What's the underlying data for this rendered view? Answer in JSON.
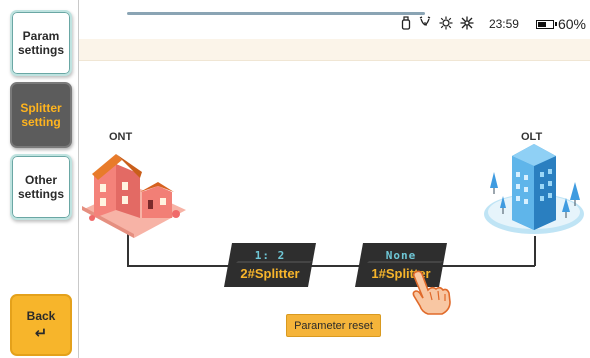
{
  "sidebar": {
    "param_settings": "Param settings",
    "splitter_setting": "Splitter setting",
    "other_settings": "Other settings",
    "back": "Back",
    "back_icon": "↵"
  },
  "status_bar": {
    "icons": [
      "usb-icon",
      "alarm-clock-icon",
      "brightness-icon",
      "sun-icon"
    ],
    "time": "23:59",
    "battery": "60%",
    "battery_level": 0.6
  },
  "diagram": {
    "ont_label": "ONT",
    "olt_label": "OLT",
    "splitter_2": {
      "ratio": "1: 2",
      "name": "2#Splitter"
    },
    "splitter_1": {
      "ratio": "None",
      "name": "1#Splitter"
    }
  },
  "actions": {
    "reset": "Parameter reset"
  },
  "colors": {
    "accent": "#f7b52b",
    "active_tab_bg": "#5c5c5c",
    "splitter_bg": "#2e2e2e",
    "ratio_text": "#6fc7d6"
  }
}
